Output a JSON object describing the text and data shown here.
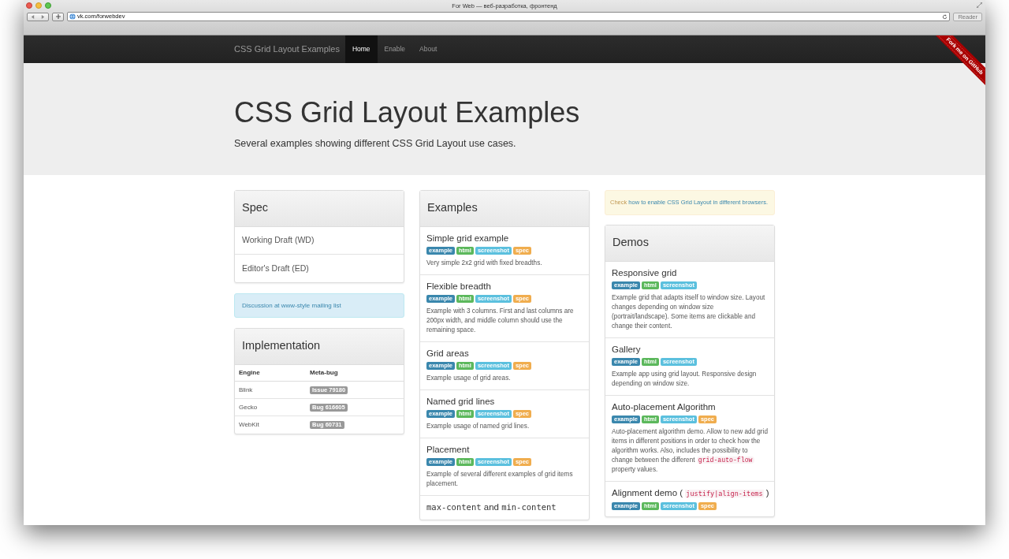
{
  "window": {
    "title": "For Web — веб-разработка, фронтенд",
    "url": "vk.com/forwebdev",
    "reader_button": "Reader"
  },
  "navbar": {
    "brand": "CSS Grid Layout Examples",
    "items": [
      {
        "label": "Home",
        "selected": true
      },
      {
        "label": "Enable",
        "selected": false
      },
      {
        "label": "About",
        "selected": false
      }
    ]
  },
  "ribbon": "Fork me on GitHub",
  "hero": {
    "title": "CSS Grid Layout Examples",
    "subtitle": "Several examples showing different CSS Grid Layout use cases."
  },
  "spec": {
    "title": "Spec",
    "items": [
      "Working Draft (WD)",
      "Editor's Draft (ED)"
    ]
  },
  "discussion_alert": "Discussion at www-style mailing list",
  "implementation": {
    "title": "Implementation",
    "columns": [
      "Engine",
      "Meta-bug"
    ],
    "rows": [
      {
        "engine": "Blink",
        "bug": "Issue 79180"
      },
      {
        "engine": "Gecko",
        "bug": "Bug 616605"
      },
      {
        "engine": "WebKit",
        "bug": "Bug 60731"
      }
    ]
  },
  "examples": {
    "title": "Examples",
    "items": [
      {
        "title": [
          {
            "kind": "text",
            "text": "Simple grid example"
          }
        ],
        "tags": [
          {
            "kind": "example",
            "label": "example"
          },
          {
            "kind": "html",
            "label": "html"
          },
          {
            "kind": "screenshot",
            "label": "screenshot"
          },
          {
            "kind": "spec",
            "label": "spec"
          }
        ],
        "description": [
          {
            "kind": "text",
            "text": "Very simple 2x2 grid with fixed breadths."
          }
        ]
      },
      {
        "title": [
          {
            "kind": "text",
            "text": "Flexible breadth"
          }
        ],
        "tags": [
          {
            "kind": "example",
            "label": "example"
          },
          {
            "kind": "html",
            "label": "html"
          },
          {
            "kind": "screenshot",
            "label": "screenshot"
          },
          {
            "kind": "spec",
            "label": "spec"
          }
        ],
        "description": [
          {
            "kind": "text",
            "text": "Example with 3 columns. First and last columns are 200px width, and middle column should use the remaining space."
          }
        ]
      },
      {
        "title": [
          {
            "kind": "text",
            "text": "Grid areas"
          }
        ],
        "tags": [
          {
            "kind": "example",
            "label": "example"
          },
          {
            "kind": "html",
            "label": "html"
          },
          {
            "kind": "screenshot",
            "label": "screenshot"
          },
          {
            "kind": "spec",
            "label": "spec"
          }
        ],
        "description": [
          {
            "kind": "text",
            "text": "Example usage of grid areas."
          }
        ]
      },
      {
        "title": [
          {
            "kind": "text",
            "text": "Named grid lines"
          }
        ],
        "tags": [
          {
            "kind": "example",
            "label": "example"
          },
          {
            "kind": "html",
            "label": "html"
          },
          {
            "kind": "screenshot",
            "label": "screenshot"
          },
          {
            "kind": "spec",
            "label": "spec"
          }
        ],
        "description": [
          {
            "kind": "text",
            "text": "Example usage of named grid lines."
          }
        ]
      },
      {
        "title": [
          {
            "kind": "text",
            "text": "Placement"
          }
        ],
        "tags": [
          {
            "kind": "example",
            "label": "example"
          },
          {
            "kind": "html",
            "label": "html"
          },
          {
            "kind": "screenshot",
            "label": "screenshot"
          },
          {
            "kind": "spec",
            "label": "spec"
          }
        ],
        "description": [
          {
            "kind": "text",
            "text": "Example of several different examples of grid items placement."
          }
        ]
      },
      {
        "title": [
          {
            "kind": "code",
            "text": "max-content"
          },
          {
            "kind": "text",
            "text": " and "
          },
          {
            "kind": "code",
            "text": "min-content"
          }
        ]
      }
    ]
  },
  "enable_alert": {
    "text": "Check ",
    "link": "how to enable CSS Grid Layout in different browsers."
  },
  "demos": {
    "title": "Demos",
    "items": [
      {
        "title": [
          {
            "kind": "text",
            "text": "Responsive grid"
          }
        ],
        "tags": [
          {
            "kind": "example",
            "label": "example"
          },
          {
            "kind": "html",
            "label": "html"
          },
          {
            "kind": "screenshot",
            "label": "screenshot"
          }
        ],
        "description": [
          {
            "kind": "text",
            "text": "Example grid that adapts itself to window size. Layout changes depending on window size (portrait/landscape). Some items are clickable and change their content."
          }
        ]
      },
      {
        "title": [
          {
            "kind": "text",
            "text": "Gallery"
          }
        ],
        "tags": [
          {
            "kind": "example",
            "label": "example"
          },
          {
            "kind": "html",
            "label": "html"
          },
          {
            "kind": "screenshot",
            "label": "screenshot"
          }
        ],
        "description": [
          {
            "kind": "text",
            "text": "Example app using grid layout. Responsive design depending on window size."
          }
        ]
      },
      {
        "title": [
          {
            "kind": "text",
            "text": "Auto-placement Algorithm"
          }
        ],
        "tags": [
          {
            "kind": "example",
            "label": "example"
          },
          {
            "kind": "html",
            "label": "html"
          },
          {
            "kind": "screenshot",
            "label": "screenshot"
          },
          {
            "kind": "spec",
            "label": "spec"
          }
        ],
        "description": [
          {
            "kind": "text",
            "text": "Auto-placement algorithm demo. Allow to new add grid items in different positions in order to check how the algorithm works. Also, includes the possibility to change between the different "
          },
          {
            "kind": "code",
            "text": "grid-auto-flow"
          },
          {
            "kind": "text",
            "text": " property values."
          }
        ]
      },
      {
        "title": [
          {
            "kind": "text",
            "text": "Alignment demo ( "
          },
          {
            "kind": "code",
            "text": "justify|align-items"
          },
          {
            "kind": "text",
            "text": " )"
          }
        ],
        "tags": [
          {
            "kind": "example",
            "label": "example"
          },
          {
            "kind": "html",
            "label": "html"
          },
          {
            "kind": "screenshot",
            "label": "screenshot"
          },
          {
            "kind": "spec",
            "label": "spec"
          }
        ]
      }
    ]
  }
}
